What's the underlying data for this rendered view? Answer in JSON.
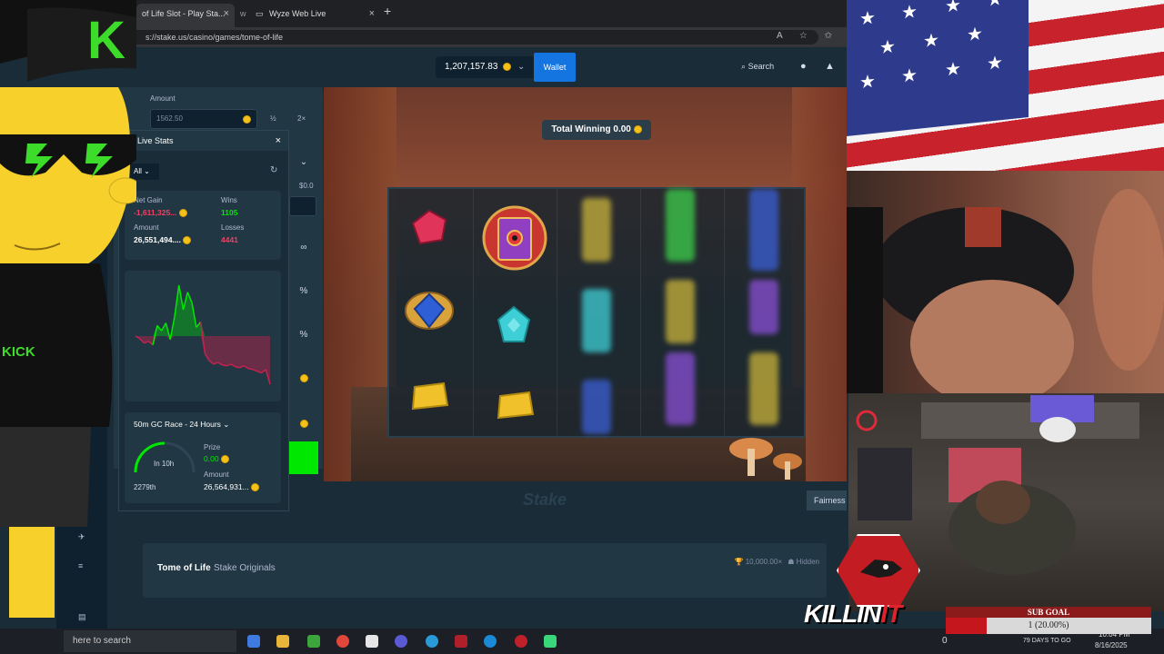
{
  "browser": {
    "tabs": [
      {
        "label": "of Life Slot - Play Sta..."
      },
      {
        "label": "Wyze Web Live"
      }
    ],
    "tab_prefix": "w",
    "new_tab": "+",
    "close": "×",
    "url": "s://stake.us/casino/games/tome-of-life"
  },
  "topnav": {
    "balance": "1,207,157.83",
    "wallet_label": "Wallet",
    "search_label": "Search"
  },
  "sidepanel": {
    "amount_label": "Amount",
    "amount_value": "1562.50",
    "half": "½",
    "double": "2×",
    "profit_value": "$0.0"
  },
  "controls": {
    "infinity": "∞",
    "percent1": "%",
    "percent2": "%"
  },
  "live_stats": {
    "title": "Live Stats",
    "filter": "All",
    "net_gain_label": "Net Gain",
    "net_gain_value": "-1,611,325...",
    "wins_label": "Wins",
    "wins_value": "1105",
    "amount_label": "Amount",
    "amount_value": "26,551,494....",
    "losses_label": "Losses",
    "losses_value": "4441",
    "chart_data": {
      "type": "area",
      "title": "",
      "xlabel": "",
      "ylabel": "",
      "values": [
        0,
        -3,
        -8,
        -6,
        -10,
        12,
        6,
        15,
        -4,
        22,
        58,
        30,
        50,
        38,
        10,
        16,
        -20,
        -28,
        -32,
        -30,
        -33,
        -34,
        -32,
        -35,
        -36,
        -34,
        -37,
        -38,
        -40,
        -42,
        -38,
        -55
      ],
      "ylim": [
        -60,
        60
      ],
      "positive_color": "#00e701",
      "negative_color": "#c4224e",
      "grid": false
    },
    "race_title": "50m GC Race - 24 Hours",
    "race_timer": "In 10h",
    "race_rank": "2279th",
    "prize_label": "Prize",
    "prize_value": "0.00",
    "race_amount_label": "Amount",
    "race_amount_value": "26,564,931...",
    "race_progress": 0.5
  },
  "game": {
    "total_winning": "Total Winning 0.00",
    "title": "Tome of Life",
    "provider": "Stake Originals",
    "max_win": "10,000.00×",
    "hidden": "Hidden",
    "fairness": "Fairness",
    "watermark": "Stake"
  },
  "taskbar": {
    "search": "here to search",
    "time": "10:04 PM",
    "date": "8/16/2025",
    "days_text": "79 DAYS TO GO",
    "zero": "0"
  },
  "overlay": {
    "kick_text": "KICK",
    "sub_goal_title": "SUB GOAL",
    "sub_goal_text": "1 (20.00%)",
    "sub_goal_progress": 0.2,
    "brand_killin": "KILLIN",
    "brand_it": "IT",
    "logo_letter": "K"
  }
}
